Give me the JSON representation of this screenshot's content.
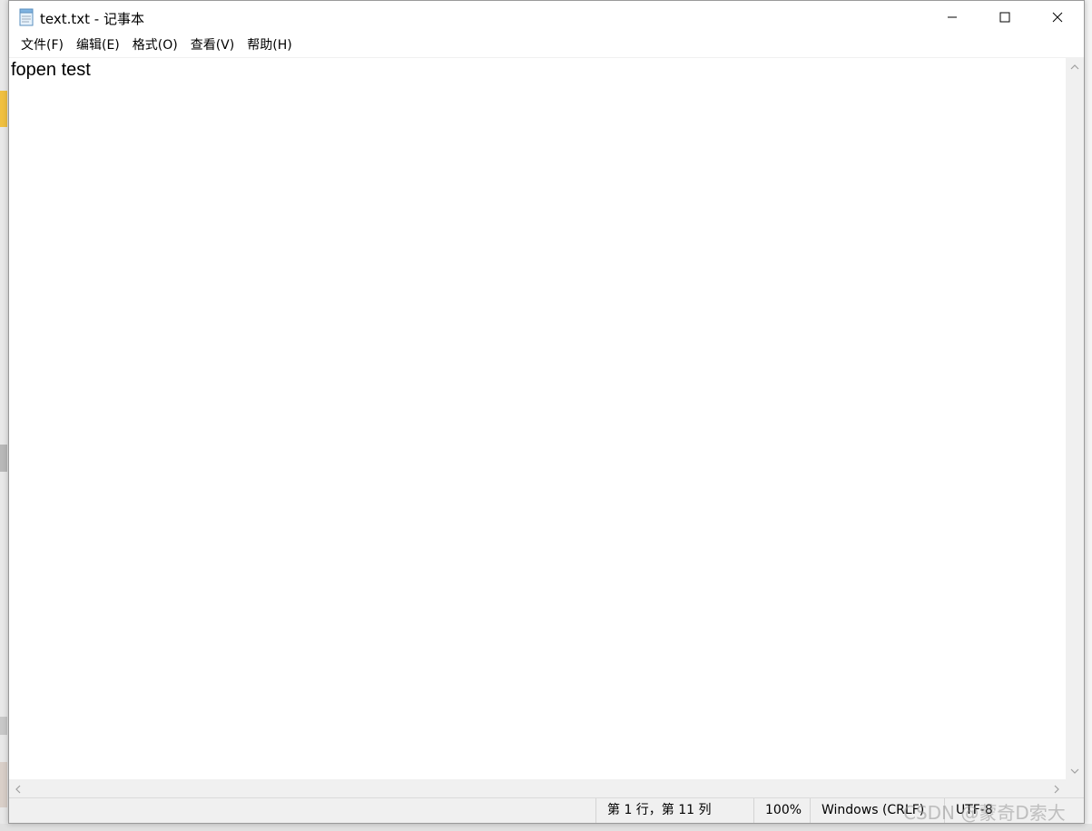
{
  "window": {
    "title": "text.txt - 记事本"
  },
  "menu": {
    "items": [
      {
        "label": "文件(F)"
      },
      {
        "label": "编辑(E)"
      },
      {
        "label": "格式(O)"
      },
      {
        "label": "查看(V)"
      },
      {
        "label": "帮助(H)"
      }
    ]
  },
  "editor": {
    "content": "fopen test"
  },
  "status": {
    "position": "第 1 行，第 11 列",
    "zoom": "100%",
    "line_ending": "Windows (CRLF)",
    "encoding": "UTF-8"
  },
  "watermark": {
    "text": "CSDN @蒙奇D索大"
  },
  "icons": {
    "app": "notepad-icon",
    "minimize": "minimize-icon",
    "maximize": "maximize-icon",
    "close": "close-icon"
  }
}
